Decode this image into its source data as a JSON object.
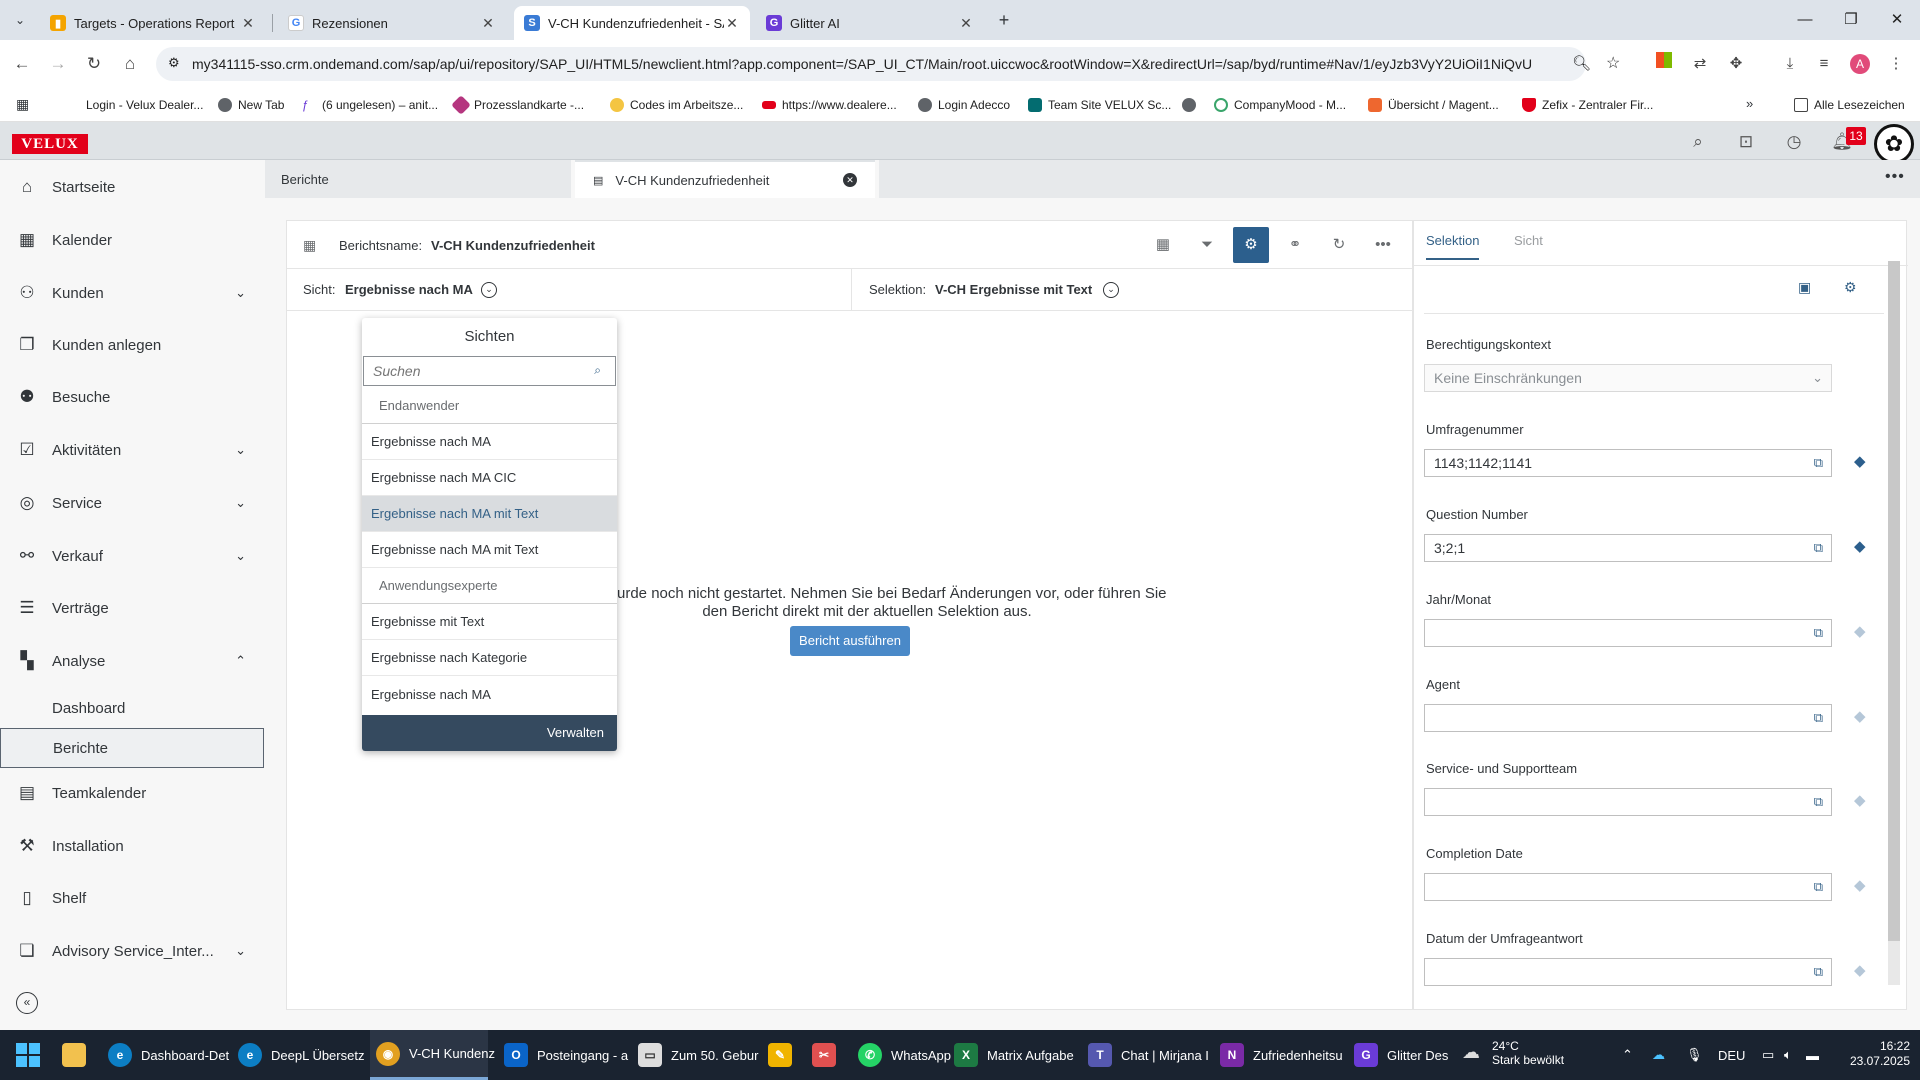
{
  "browser": {
    "tabs": [
      {
        "title": "Targets - Operations Report",
        "active": false
      },
      {
        "title": "Rezensionen",
        "active": false
      },
      {
        "title": "V-CH Kundenzufriedenheit - SAP",
        "active": true
      },
      {
        "title": "Glitter AI",
        "active": false
      }
    ],
    "url": "my341115-sso.crm.ondemand.com/sap/ap/ui/repository/SAP_UI/HTML5/newclient.html?app.component=/SAP_UI_CT/Main/root.uiccwoc&rootWindow=X&redirectUrl=/sap/byd/runtime#Nav/1/eyJzb3VyY2UiOiI1NiQvU0...",
    "bookmarks": [
      "Login - Velux Dealer...",
      "New Tab",
      "(6 ungelesen) – anit...",
      "Prozesslandkarte -...",
      "Codes im Arbeitsze...",
      "https://www.dealere...",
      "Login Adecco",
      "Team Site VELUX Sc...",
      "",
      "CompanyMood - M...",
      "Übersicht / Magent...",
      "Zefix - Zentraler Fir..."
    ],
    "all_bookmarks": "Alle Lesezeichen"
  },
  "shell": {
    "logo": "VELUX",
    "notification_count": "13"
  },
  "sidebar": {
    "items": [
      {
        "label": "Startseite",
        "icon": "home-icon",
        "expandable": false
      },
      {
        "label": "Kalender",
        "icon": "calendar-icon",
        "expandable": false
      },
      {
        "label": "Kunden",
        "icon": "customers-icon",
        "expandable": true
      },
      {
        "label": "Kunden anlegen",
        "icon": "copy-icon",
        "expandable": false
      },
      {
        "label": "Besuche",
        "icon": "visit-icon",
        "expandable": false
      },
      {
        "label": "Aktivitäten",
        "icon": "activities-icon",
        "expandable": true
      },
      {
        "label": "Service",
        "icon": "service-icon",
        "expandable": true
      },
      {
        "label": "Verkauf",
        "icon": "sales-icon",
        "expandable": true
      },
      {
        "label": "Verträge",
        "icon": "contract-icon",
        "expandable": false
      },
      {
        "label": "Analyse",
        "icon": "analysis-icon",
        "expandable": true,
        "expanded": true
      }
    ],
    "subitems": [
      {
        "label": "Dashboard",
        "selected": false
      },
      {
        "label": "Berichte",
        "selected": true
      }
    ],
    "items_after": [
      {
        "label": "Teamkalender",
        "icon": "team-calendar-icon",
        "expandable": false
      },
      {
        "label": "Installation",
        "icon": "installation-icon",
        "expandable": false
      },
      {
        "label": "Shelf",
        "icon": "shelf-icon",
        "expandable": false
      },
      {
        "label": "Advisory Service_Inter...",
        "icon": "advisory-icon",
        "expandable": true
      }
    ]
  },
  "app_tabs": [
    {
      "label": "Berichte",
      "active": false
    },
    {
      "label": "V-CH Kundenzufriedenheit",
      "active": true
    }
  ],
  "report": {
    "name_label": "Berichtsname:",
    "name": "V-CH Kundenzufriedenheit",
    "view_label": "Sicht:",
    "view": "Ergebnisse nach MA",
    "selection_label": "Selektion:",
    "selection": "V-CH Ergebnisse mit Text",
    "message_line1": "urde noch nicht gestartet. Nehmen Sie bei Bedarf Änderungen vor, oder führen Sie",
    "message_line2": "den Bericht direkt mit der aktuellen Selektion aus.",
    "run_button": "Bericht ausführen"
  },
  "views_dropdown": {
    "title": "Sichten",
    "search_placeholder": "Suchen",
    "items": [
      {
        "label": "Endanwender",
        "group": true
      },
      {
        "label": "Ergebnisse nach MA"
      },
      {
        "label": "Ergebnisse nach MA CIC"
      },
      {
        "label": "Ergebnisse nach MA mit Text",
        "highlighted": true
      },
      {
        "label": "Ergebnisse nach MA mit Text"
      },
      {
        "label": "Anwendungsexperte",
        "group": true
      },
      {
        "label": "Ergebnisse mit Text"
      },
      {
        "label": "Ergebnisse nach Kategorie"
      },
      {
        "label": "Ergebnisse nach MA"
      }
    ],
    "manage": "Verwalten"
  },
  "right_panel": {
    "tabs": [
      {
        "label": "Selektion",
        "active": true
      },
      {
        "label": "Sicht",
        "active": false
      }
    ],
    "auth_label": "Berechtigungskontext",
    "auth_value": "Keine Einschränkungen",
    "fields": [
      {
        "label": "Umfragenummer",
        "value": "1143;1142;1141"
      },
      {
        "label": "Question Number",
        "value": "3;2;1"
      },
      {
        "label": "Jahr/Monat",
        "value": ""
      },
      {
        "label": "Agent",
        "value": ""
      },
      {
        "label": "Service- und Supportteam",
        "value": ""
      },
      {
        "label": "Completion Date",
        "value": ""
      },
      {
        "label": "Datum der Umfrageantwort",
        "value": ""
      }
    ]
  },
  "taskbar": {
    "apps": [
      {
        "label": "Dashboard-Det",
        "color": "#0c7ec4"
      },
      {
        "label": "DeepL Übersetz",
        "color": "#0c7ec4"
      },
      {
        "label": "V-CH Kundenz",
        "color": "#e2a020"
      },
      {
        "label": "Posteingang - a",
        "color": "#0a64c8"
      },
      {
        "label": "Zum 50. Gebur",
        "color": "#dddddd"
      },
      {
        "label": "",
        "color": "#f0b400"
      },
      {
        "label": "",
        "color": "#e05050"
      },
      {
        "label": "WhatsApp",
        "color": "#25d366"
      },
      {
        "label": "Matrix Aufgabe",
        "color": "#1d7a43"
      },
      {
        "label": "Chat | Mirjana I",
        "color": "#5558af"
      },
      {
        "label": "Zufriedenheitsu",
        "color": "#7a2aa6"
      },
      {
        "label": "Glitter Des",
        "color": "#6a3bd6"
      }
    ],
    "weather_temp": "24°C",
    "weather_desc": "Stark bewölkt",
    "lang": "DEU",
    "time": "16:22",
    "date": "23.07.2025"
  }
}
